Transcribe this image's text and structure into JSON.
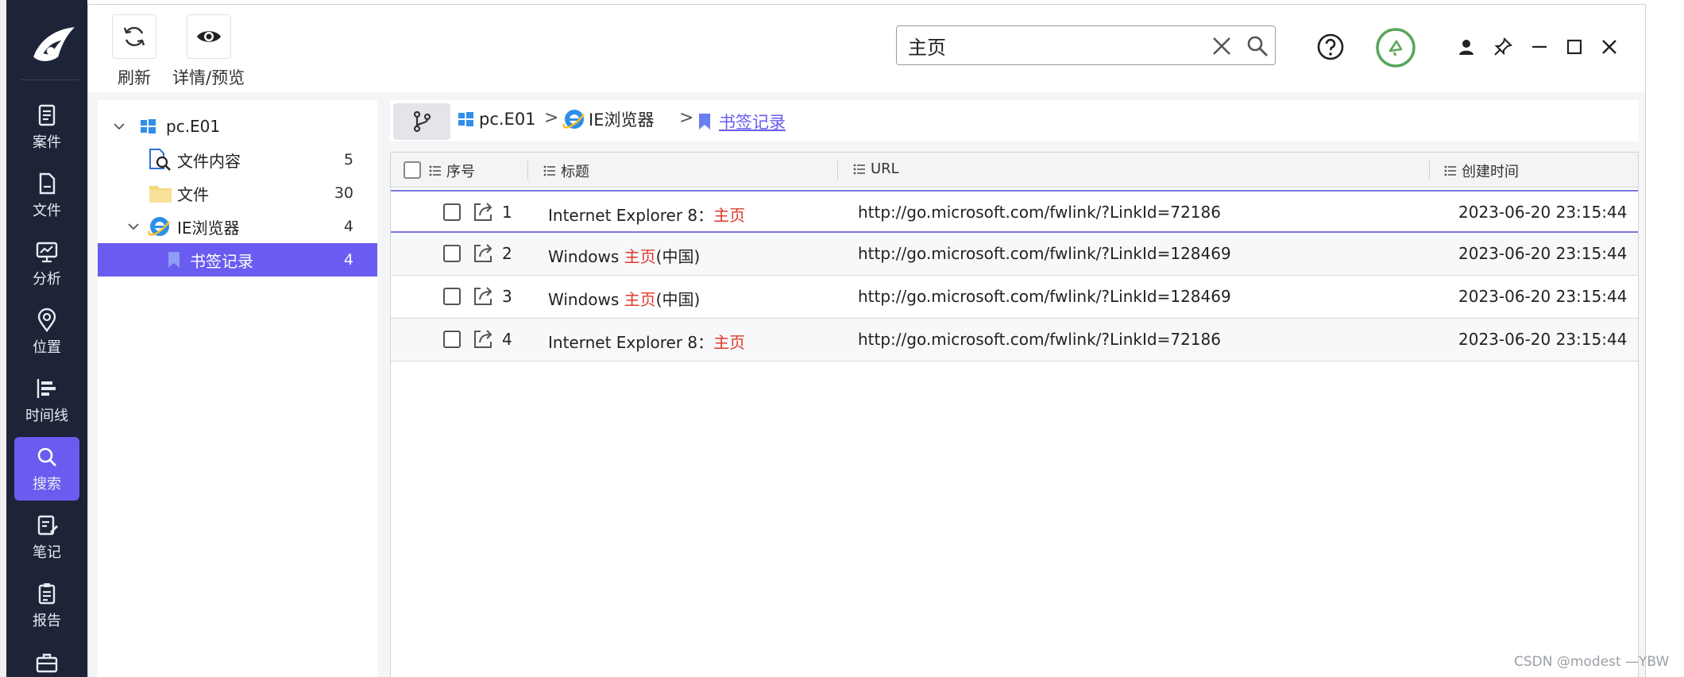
{
  "colors": {
    "accent": "#6a5cf0",
    "sidebar": "#1e2437",
    "highlight": "#e03a2c",
    "success": "#5aa55a"
  },
  "sidebar": {
    "items": [
      {
        "label": "案件",
        "icon": "case-icon"
      },
      {
        "label": "文件",
        "icon": "file-icon"
      },
      {
        "label": "分析",
        "icon": "analysis-icon"
      },
      {
        "label": "位置",
        "icon": "location-icon"
      },
      {
        "label": "时间线",
        "icon": "timeline-icon"
      },
      {
        "label": "搜索",
        "icon": "search-icon",
        "active": true
      },
      {
        "label": "笔记",
        "icon": "note-icon"
      },
      {
        "label": "报告",
        "icon": "report-icon"
      },
      {
        "label": "",
        "icon": "toolbox-icon"
      }
    ]
  },
  "toolbar": {
    "refresh_label": "刷新",
    "preview_label": "详情/预览"
  },
  "search": {
    "value": "主页"
  },
  "tree": {
    "nodes": [
      {
        "label": "pc.E01",
        "count": ""
      },
      {
        "label": "文件内容",
        "count": "5"
      },
      {
        "label": "文件",
        "count": "30"
      },
      {
        "label": "IE浏览器",
        "count": "4"
      },
      {
        "label": "书签记录",
        "count": "4"
      }
    ]
  },
  "breadcrumb": {
    "items": [
      "pc.E01",
      "IE浏览器",
      "书签记录"
    ],
    "separator": ">"
  },
  "table": {
    "columns": [
      "序号",
      "标题",
      "URL",
      "创建时间"
    ],
    "rows": [
      {
        "no": "1",
        "title_prefix": "Internet Explorer 8：",
        "title_match": "主页",
        "title_suffix": "",
        "url": "http://go.microsoft.com/fwlink/?LinkId=72186",
        "time": "2023-06-20 23:15:44"
      },
      {
        "no": "2",
        "title_prefix": "Windows ",
        "title_match": "主页",
        "title_suffix": "(中国)",
        "url": "http://go.microsoft.com/fwlink/?LinkId=128469",
        "time": "2023-06-20 23:15:44"
      },
      {
        "no": "3",
        "title_prefix": "Windows ",
        "title_match": "主页",
        "title_suffix": "(中国)",
        "url": "http://go.microsoft.com/fwlink/?LinkId=128469",
        "time": "2023-06-20 23:15:44"
      },
      {
        "no": "4",
        "title_prefix": "Internet Explorer 8：",
        "title_match": "主页",
        "title_suffix": "",
        "url": "http://go.microsoft.com/fwlink/?LinkId=72186",
        "time": "2023-06-20 23:15:44"
      }
    ]
  },
  "watermark": "CSDN @modest —YBW"
}
